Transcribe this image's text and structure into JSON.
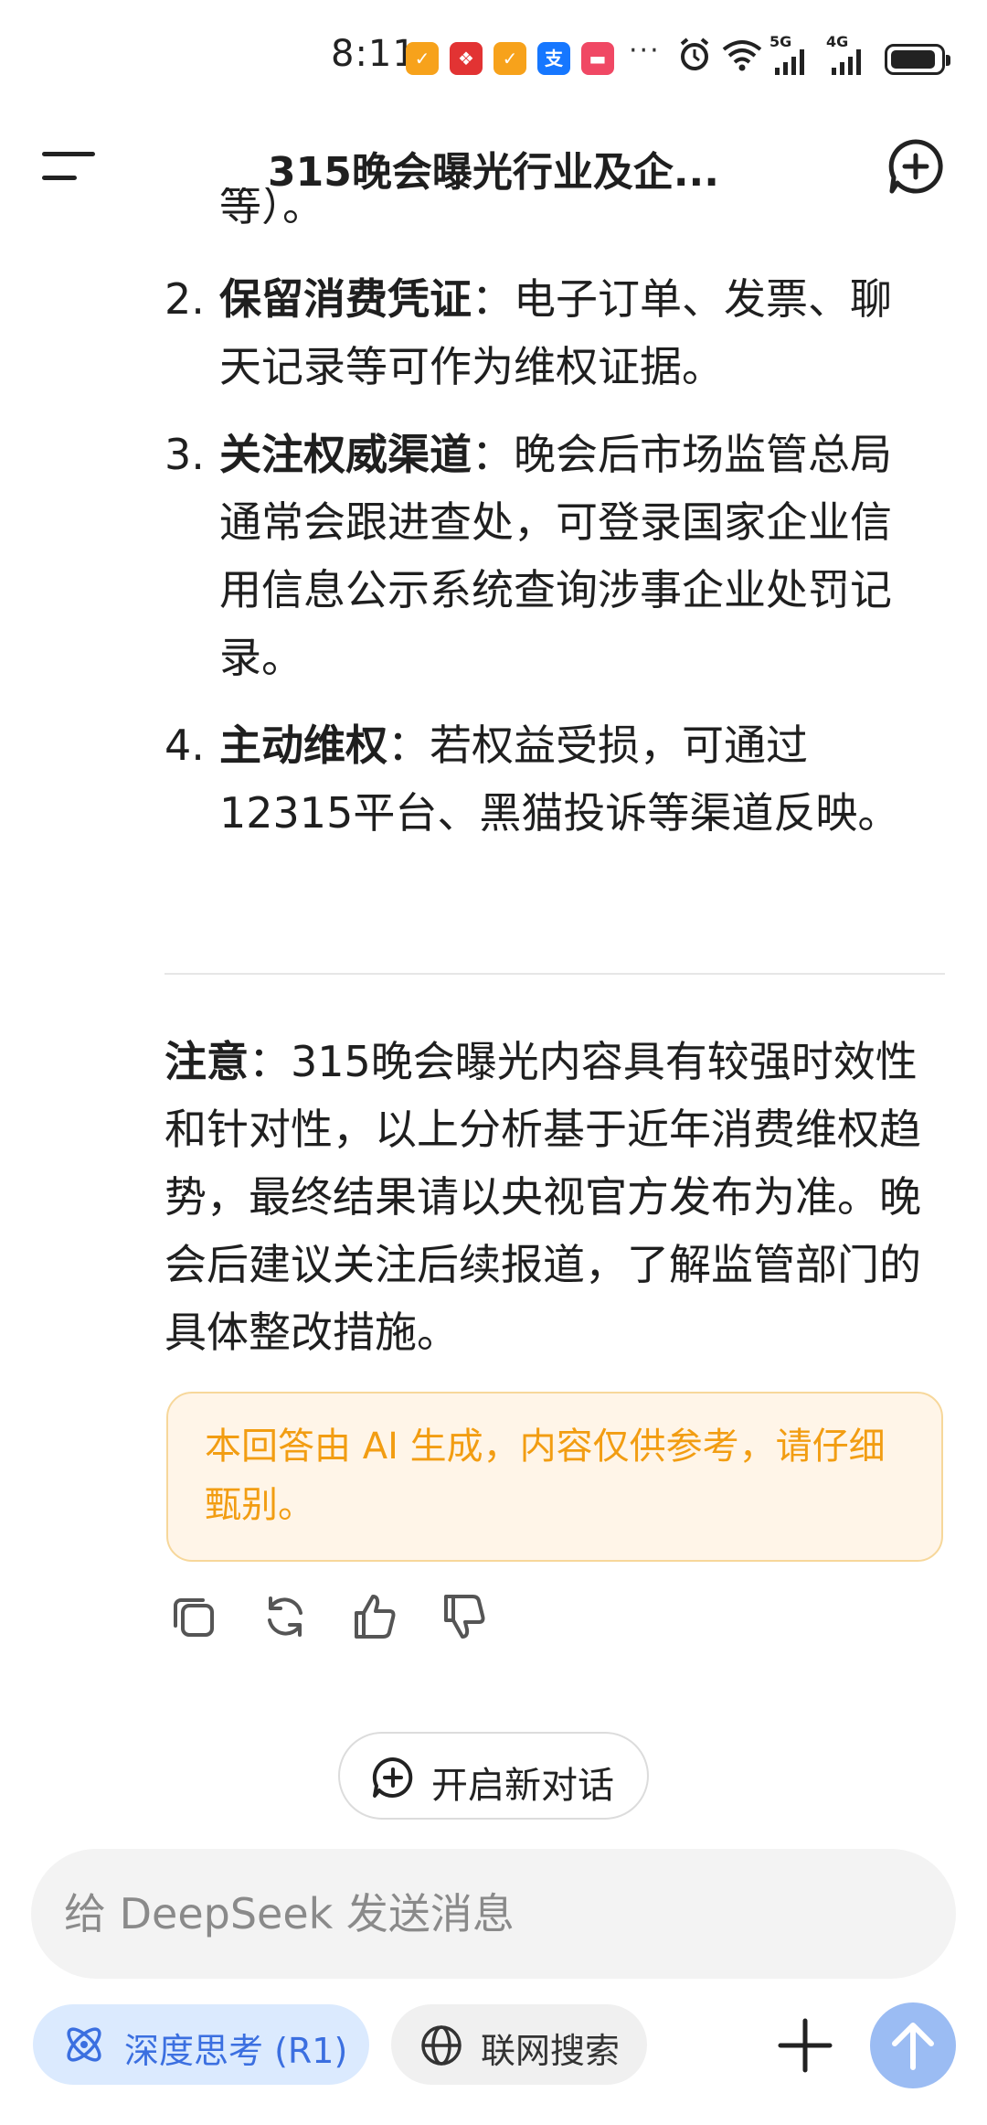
{
  "status_bar": {
    "time": "8:11",
    "more": "···",
    "signal_5g": "5G",
    "signal_4g": "4G",
    "notif_colors": [
      "#f7a21b",
      "#e23333",
      "#f7a21b",
      "#1677ff",
      "#f04864"
    ]
  },
  "header": {
    "title": "315晚会曝光行业及企..."
  },
  "content": {
    "clipped_top": "等）。",
    "items": [
      {
        "num": "2.",
        "bold": "保留消费凭证",
        "text": "：电子订单、发票、聊天记录等可作为维权证据。"
      },
      {
        "num": "3.",
        "bold": "关注权威渠道",
        "text": "：晚会后市场监管总局通常会跟进查处，可登录国家企业信用信息公示系统查询涉事企业处罚记录。"
      },
      {
        "num": "4.",
        "bold": "主动维权",
        "text": "：若权益受损，可通过12315平台、黑猫投诉等渠道反映。"
      }
    ],
    "note_label": "注意",
    "note_text": "：315晚会曝光内容具有较强时效性和针对性，以上分析基于近年消费维权趋势，最终结果请以央视官方发布为准。晚会后建议关注后续报道，了解监管部门的具体整改措施。"
  },
  "disclaimer": "本回答由 AI 生成，内容仅供参考，请仔细甄别。",
  "actions": [
    "copy-icon",
    "regenerate-icon",
    "thumbs-up-icon",
    "thumbs-down-icon"
  ],
  "new_chat_button": "开启新对话",
  "input": {
    "placeholder": "给 DeepSeek 发送消息"
  },
  "chips": {
    "deep_think": "深度思考 (R1)",
    "web_search": "联网搜索"
  },
  "colors": {
    "accent": "#3b6fe0",
    "disclaimer_text": "#f29d12",
    "disclaimer_bg": "#fff5e8",
    "send_button": "#9bbcf3"
  }
}
